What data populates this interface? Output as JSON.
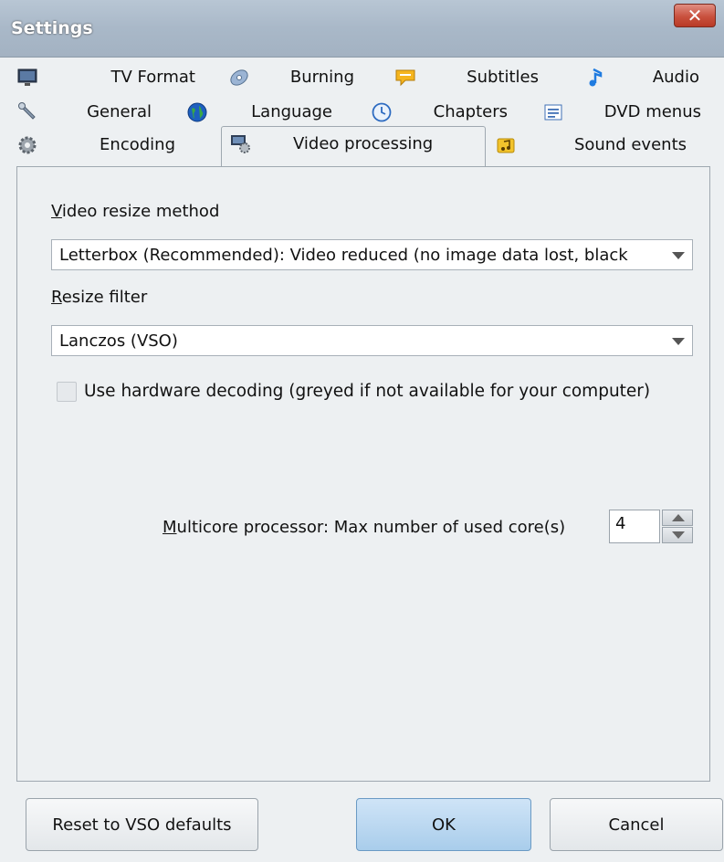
{
  "window": {
    "title": "Settings",
    "close_glyph": "✕"
  },
  "tabs": [
    {
      "label": "TV Format",
      "icon": "monitor-icon"
    },
    {
      "label": "Burning",
      "icon": "disc-icon"
    },
    {
      "label": "Subtitles",
      "icon": "speech-bubble-icon"
    },
    {
      "label": "Audio",
      "icon": "music-note-icon"
    },
    {
      "label": "General",
      "icon": "wrench-icon"
    },
    {
      "label": "Language",
      "icon": "globe-icon"
    },
    {
      "label": "Chapters",
      "icon": "clock-icon"
    },
    {
      "label": "DVD menus",
      "icon": "menu-list-icon"
    },
    {
      "label": "Encoding",
      "icon": "gear-icon"
    },
    {
      "label": "Video processing",
      "icon": "video-gear-icon",
      "active": true
    },
    {
      "label": "Sound events",
      "icon": "music-folder-icon"
    }
  ],
  "panel": {
    "resize_method_label": "Video resize method",
    "resize_method_value": "Letterbox (Recommended): Video reduced (no image data lost, black",
    "resize_filter_label": "Resize filter",
    "resize_filter_value": "Lanczos (VSO)",
    "hw_decoding_label": "Use hardware decoding (greyed if not  available for your computer)",
    "hw_decoding_checked": false,
    "multicore_label": "Multicore processor: Max number of used core(s)",
    "multicore_value": "4"
  },
  "buttons": {
    "reset": "Reset to VSO defaults",
    "ok": "OK",
    "cancel": "Cancel"
  },
  "colors": {
    "ok_button": "#a9cdeb",
    "titlebar": "#a9b8c8",
    "close_button": "#c9513e"
  }
}
